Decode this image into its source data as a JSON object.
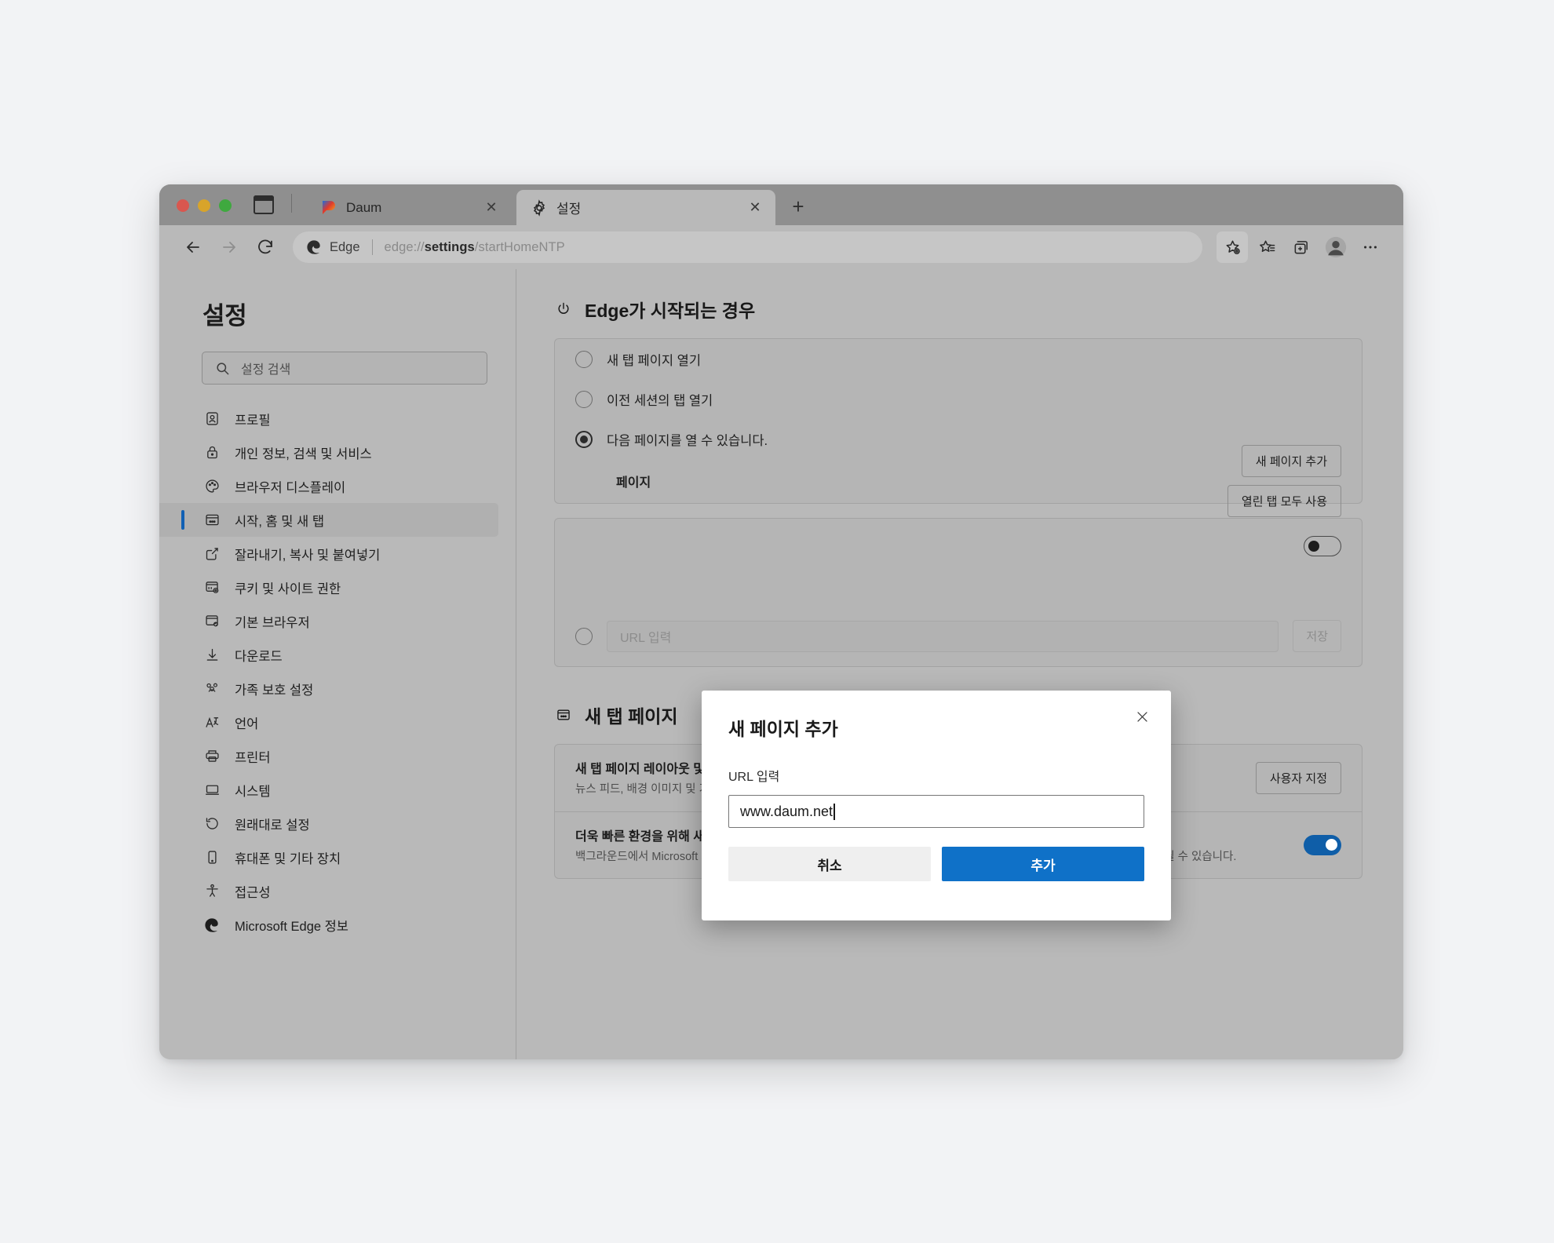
{
  "window": {
    "traffic_lights": [
      "close",
      "minimize",
      "zoom"
    ],
    "tab_list_icon": "tab-list-icon"
  },
  "tabs": [
    {
      "title": "Daum",
      "favicon": "daum-favicon",
      "active": false,
      "close_label": "✕"
    },
    {
      "title": "설정",
      "favicon": "gear-icon",
      "active": true,
      "close_label": "✕"
    }
  ],
  "newtab_label": "+",
  "toolbar": {
    "back_icon": "back-arrow-icon",
    "forward_icon": "forward-arrow-icon",
    "reload_icon": "reload-icon",
    "edge_label": "Edge",
    "url_prefix": "edge://",
    "url_bold": "settings",
    "url_suffix": "/startHomeNTP",
    "icons": [
      "add-favorite-icon",
      "favorites-icon",
      "collections-icon",
      "profile-avatar-icon",
      "more-options-icon"
    ]
  },
  "sidebar": {
    "title": "설정",
    "search_placeholder": "설정 검색",
    "search_icon": "search-icon",
    "items": [
      {
        "label": "프로필",
        "icon": "profile-icon",
        "selected": false
      },
      {
        "label": "개인 정보, 검색 및 서비스",
        "icon": "lock-icon",
        "selected": false
      },
      {
        "label": "브라우저 디스플레이",
        "icon": "palette-icon",
        "selected": false
      },
      {
        "label": "시작, 홈 및 새 탭",
        "icon": "startup-icon",
        "selected": true
      },
      {
        "label": "잘라내기, 복사 및 붙여넣기",
        "icon": "share-icon",
        "selected": false
      },
      {
        "label": "쿠키 및 사이트 권한",
        "icon": "cookies-icon",
        "selected": false
      },
      {
        "label": "기본 브라우저",
        "icon": "default-browser-icon",
        "selected": false
      },
      {
        "label": "다운로드",
        "icon": "download-icon",
        "selected": false
      },
      {
        "label": "가족 보호 설정",
        "icon": "family-icon",
        "selected": false
      },
      {
        "label": "언어",
        "icon": "language-icon",
        "selected": false
      },
      {
        "label": "프린터",
        "icon": "printer-icon",
        "selected": false
      },
      {
        "label": "시스템",
        "icon": "system-icon",
        "selected": false
      },
      {
        "label": "원래대로 설정",
        "icon": "reset-icon",
        "selected": false
      },
      {
        "label": "휴대폰 및 기타 장치",
        "icon": "phone-icon",
        "selected": false
      },
      {
        "label": "접근성",
        "icon": "accessibility-icon",
        "selected": false
      },
      {
        "label": "Microsoft Edge 정보",
        "icon": "edge-logo-icon",
        "selected": false
      }
    ]
  },
  "main": {
    "startup_section": {
      "heading": "Edge가 시작되는 경우",
      "heading_icon": "power-icon",
      "options": [
        {
          "label": "새 탭 페이지 열기",
          "checked": false
        },
        {
          "label": "이전 세션의 탭 열기",
          "checked": false
        },
        {
          "label": "다음 페이지를 열 수 있습니다.",
          "checked": true
        }
      ],
      "pages_label": "페이지",
      "add_page_button": "새 페이지 추가",
      "use_open_tabs_button": "열린 탭 모두 사용"
    },
    "home_section": {
      "toggle_state": "off",
      "url_placeholder": "URL 입력",
      "save_button": "저장"
    },
    "newtab_section": {
      "heading": "새 탭 페이지",
      "heading_icon": "newtab-page-icon",
      "rows": [
        {
          "title": "새 탭 페이지 레이아웃 및 콘텐츠 사용자 지정",
          "subtitle": "뉴스 피드, 배경 이미지 및 기타 페이지 설정 제어",
          "control": "button",
          "button_label": "사용자 지정"
        },
        {
          "title": "더욱 빠른 환경을 위해 새 탭 페이지를 미리 로드",
          "subtitle": "백그라운드에서 Microsoft 새 탭 페이지를 로드하여 더 빠르게 만듭니다. 쿠키를 허용하는 경우 로드되는 콘텐츠에 쿠키가 포함될 수 있습니다.",
          "control": "toggle",
          "toggle_state": "on"
        }
      ]
    }
  },
  "dialog": {
    "title": "새 페이지 추가",
    "close_icon": "close-icon",
    "field_label": "URL 입력",
    "input_value": "www.daum.net",
    "cancel_button": "취소",
    "add_button": "추가"
  },
  "colors": {
    "accent_blue": "#0f71c8",
    "selected_indicator": "#1160b4",
    "toggle_on": "#0f5ea8",
    "page_background": "#f2f3f5"
  }
}
